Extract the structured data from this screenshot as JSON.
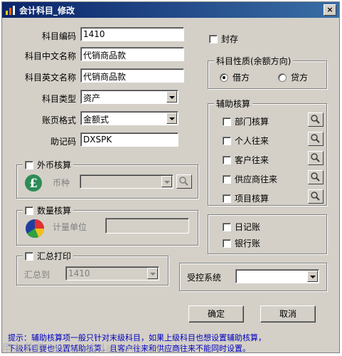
{
  "window": {
    "title": "会计科目_修改",
    "close_glyph": "×"
  },
  "form": {
    "code_label": "科目编码",
    "code_value": "1410",
    "cn_name_label": "科目中文名称",
    "cn_name_value": "代销商品款",
    "en_name_label": "科目英文名称",
    "en_name_value": "代销商品款",
    "type_label": "科目类型",
    "type_value": "资产",
    "format_label": "账页格式",
    "format_value": "金额式",
    "mnemonic_label": "助记码",
    "mnemonic_value": "DXSPK"
  },
  "sealed": {
    "label": "封存",
    "checked": false
  },
  "nature": {
    "title": "科目性质(余额方向)",
    "debit_label": "借方",
    "credit_label": "贷方",
    "selected": "借方"
  },
  "aux": {
    "title": "辅助核算",
    "items": [
      "部门核算",
      "个人往来",
      "客户往来",
      "供应商往来",
      "项目核算"
    ]
  },
  "journal": {
    "daily_label": "日记账",
    "bank_label": "银行账"
  },
  "foreign": {
    "title": "外币核算",
    "currency_label": "币种",
    "currency_value": ""
  },
  "quantity": {
    "title": "数量核算",
    "unit_label": "计量单位",
    "unit_value": ""
  },
  "summary": {
    "title": "汇总打印",
    "to_label": "汇总到",
    "to_value": "1410"
  },
  "controlled": {
    "label": "受控系统",
    "value": ""
  },
  "buttons": {
    "ok": "确定",
    "cancel": "取消"
  },
  "hint": {
    "line1": "提示：辅助核算项一般只针对末级科目，如果上级科目也想设置辅助核算，",
    "line2": "下级科目要也设置辅助核算，且客户往来和供应商往来不能同时设置。"
  },
  "watermark": "用友软件 www.ufida.com.cn",
  "colors": {
    "title_start": "#0a246a",
    "title_end": "#3a6ea5",
    "hint": "#0000c0",
    "face": "#d4d0c8"
  }
}
